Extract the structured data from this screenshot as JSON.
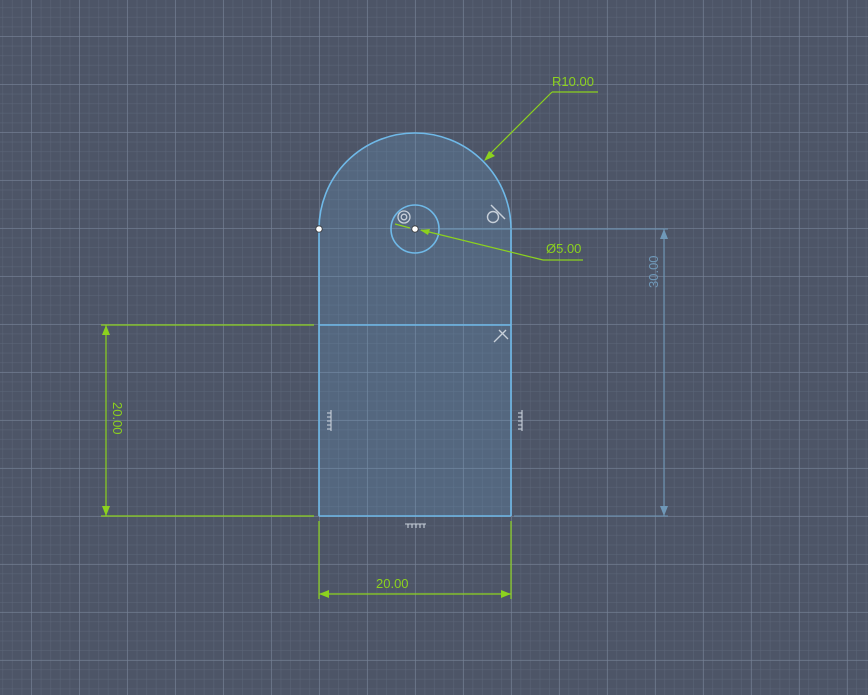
{
  "sketch": {
    "dimensions": {
      "radius_label": "R10.00",
      "diameter_label": "Ø5.00",
      "height_label": "30.00",
      "left_height_label": "20.00",
      "width_label": "20.00"
    },
    "colors": {
      "profile": "#6fb9e8",
      "profile_fill": "rgba(110,170,215,0.22)",
      "driving_dimension": "#8cd21e",
      "driven_dimension": "#6f98b8"
    }
  }
}
